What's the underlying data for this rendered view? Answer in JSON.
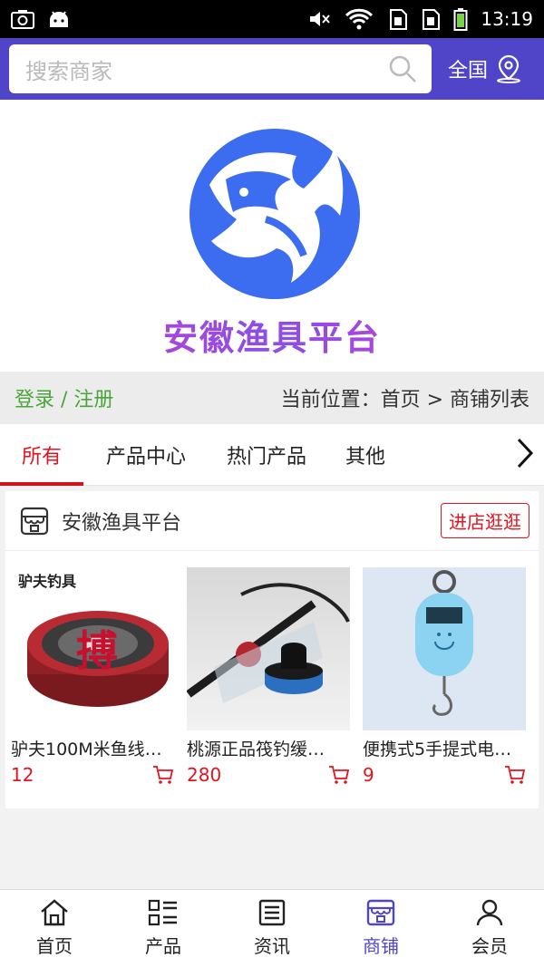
{
  "status_bar": {
    "time": "13:19",
    "left_icons": [
      "screenshot-icon",
      "android-icon"
    ],
    "right_icons": [
      "mute-icon",
      "wifi-icon",
      "sim1-icon",
      "sim2-icon",
      "battery-icon"
    ]
  },
  "search": {
    "placeholder": "搜索商家",
    "region_label": "全国"
  },
  "banner": {
    "brand_name": "安徽渔具平台"
  },
  "crumb": {
    "login_label": "登录 / 注册",
    "location": "当前位置：首页 > 商铺列表"
  },
  "tabs": [
    {
      "label": "所有",
      "active": true
    },
    {
      "label": "产品中心",
      "active": false
    },
    {
      "label": "热门产品",
      "active": false
    },
    {
      "label": "其他",
      "active": false
    }
  ],
  "shop": {
    "name": "安徽渔具平台",
    "enter_label": "进店逛逛",
    "products": [
      {
        "name": "驴夫100M米鱼线…",
        "price": "12",
        "image_text": "驴夫钓具"
      },
      {
        "name": "桃源正品筏钓缓…",
        "price": "280"
      },
      {
        "name": "便携式5手提式电…",
        "price": "9"
      }
    ]
  },
  "bottom_nav": [
    {
      "label": "首页",
      "icon": "home-icon",
      "active": false
    },
    {
      "label": "产品",
      "icon": "grid-list-icon",
      "active": false
    },
    {
      "label": "资讯",
      "icon": "news-icon",
      "active": false
    },
    {
      "label": "商铺",
      "icon": "shop-icon",
      "active": true
    },
    {
      "label": "会员",
      "icon": "user-icon",
      "active": false
    }
  ],
  "colors": {
    "brand": "#5045c9",
    "accent_red": "#e3141e",
    "login_green": "#4aa63a"
  }
}
